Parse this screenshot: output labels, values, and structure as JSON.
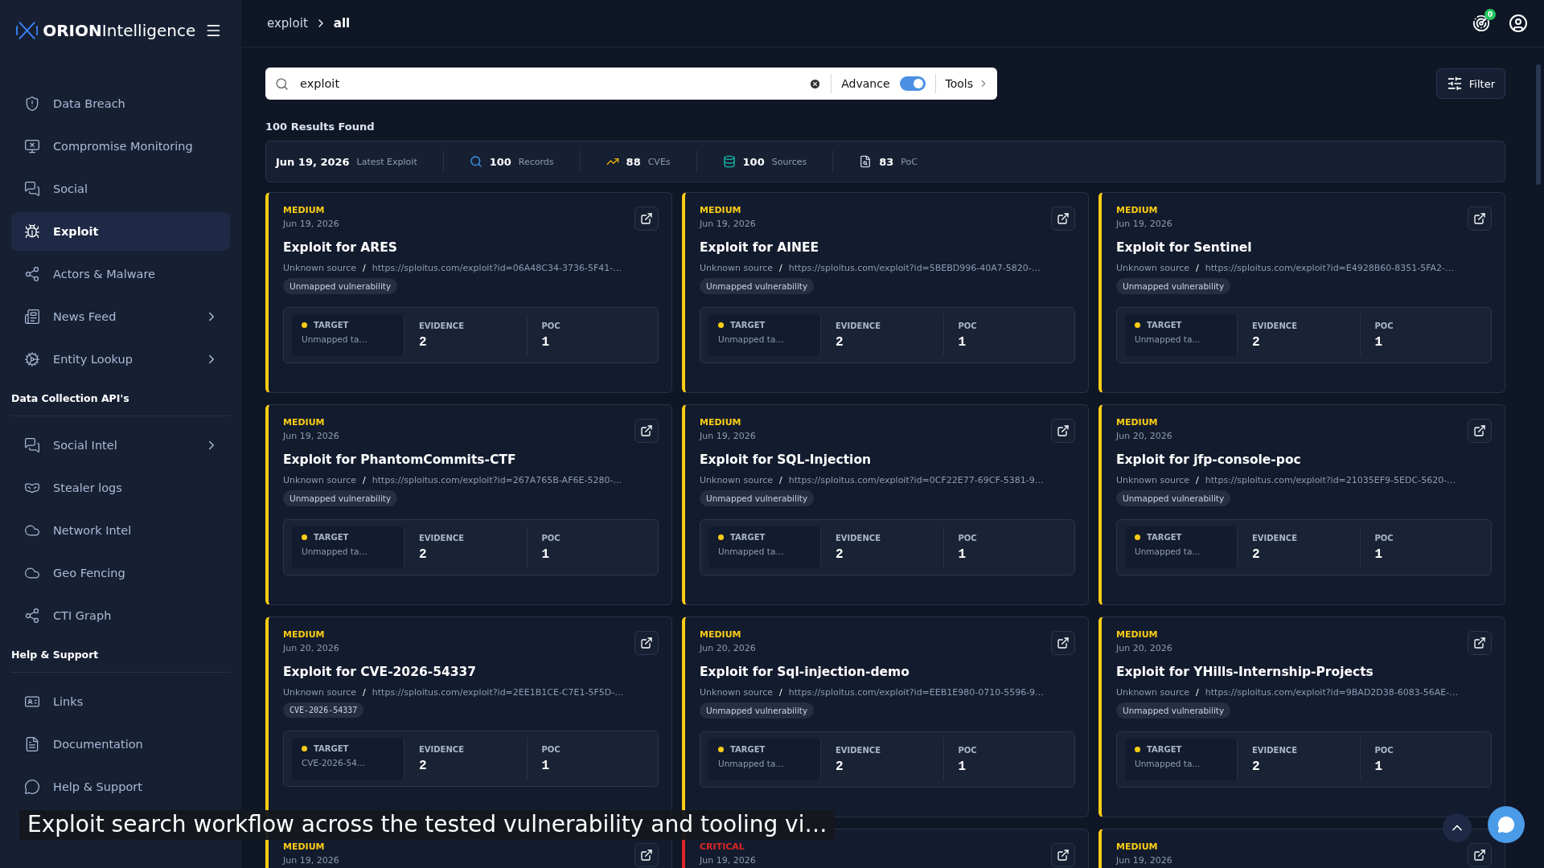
{
  "brand": {
    "name": "ORION",
    "suffix": "Intelligence"
  },
  "sidebar": {
    "items": [
      {
        "kind": "item",
        "label": "Data Breach",
        "selected": false,
        "submenu": false
      },
      {
        "kind": "item",
        "label": "Compromise Monitoring",
        "selected": false,
        "submenu": false
      },
      {
        "kind": "item",
        "label": "Social",
        "selected": false,
        "submenu": false
      },
      {
        "kind": "item",
        "label": "Exploit",
        "selected": true,
        "submenu": false
      },
      {
        "kind": "item",
        "label": "Actors & Malware",
        "selected": false,
        "submenu": false
      },
      {
        "kind": "item",
        "label": "News Feed",
        "selected": false,
        "submenu": true
      },
      {
        "kind": "item",
        "label": "Entity Lookup",
        "selected": false,
        "submenu": true
      },
      {
        "kind": "section",
        "label": "Data Collection API's"
      },
      {
        "kind": "item",
        "label": "Social Intel",
        "selected": false,
        "submenu": true
      },
      {
        "kind": "item",
        "label": "Stealer logs",
        "selected": false,
        "submenu": false
      },
      {
        "kind": "item",
        "label": "Network Intel",
        "selected": false,
        "submenu": false
      },
      {
        "kind": "item",
        "label": "Geo Fencing",
        "selected": false,
        "submenu": false
      },
      {
        "kind": "item",
        "label": "CTI Graph",
        "selected": false,
        "submenu": false
      },
      {
        "kind": "section",
        "label": "Help & Support"
      },
      {
        "kind": "item",
        "label": "Links",
        "selected": false,
        "submenu": false
      },
      {
        "kind": "item",
        "label": "Documentation",
        "selected": false,
        "submenu": false
      },
      {
        "kind": "item",
        "label": "Help & Support",
        "selected": false,
        "submenu": false
      }
    ]
  },
  "breadcrumb": [
    "exploit",
    "all"
  ],
  "notifications": {
    "count": "0"
  },
  "search": {
    "value": "exploit",
    "advance_label": "Advance",
    "advance_on": true,
    "tools_label": "Tools"
  },
  "filter_button": "Filter",
  "results_label": "100 Results Found",
  "stats": [
    {
      "kind": "date",
      "value": "Jun 19, 2026",
      "label": "Latest Exploit"
    },
    {
      "kind": "records",
      "value": "100",
      "label": "Records"
    },
    {
      "kind": "cves",
      "value": "88",
      "label": "CVEs"
    },
    {
      "kind": "sources",
      "value": "100",
      "label": "Sources"
    },
    {
      "kind": "poc",
      "value": "83",
      "label": "PoC"
    }
  ],
  "cards": [
    {
      "kind": "plain",
      "severity": "MEDIUM",
      "color": "#facc15",
      "date": "Jun 19, 2026",
      "title": "Exploit for ARES",
      "source": "Unknown source",
      "separator": "/",
      "url": "https://sploitus.com/exploit?id=06A48C34-3736-5F41-…",
      "tag": "Unmapped vulnerability",
      "target_label": "TARGET",
      "target": "Unmapped ta…",
      "evidence_label": "EVIDENCE",
      "evidence": "2",
      "poc_label": "POC",
      "poc": "1"
    },
    {
      "kind": "plain",
      "severity": "MEDIUM",
      "color": "#facc15",
      "date": "Jun 19, 2026",
      "title": "Exploit for AINEE",
      "source": "Unknown source",
      "separator": "/",
      "url": "https://sploitus.com/exploit?id=5BEBD996-40A7-5820-…",
      "tag": "Unmapped vulnerability",
      "target_label": "TARGET",
      "target": "Unmapped ta…",
      "evidence_label": "EVIDENCE",
      "evidence": "2",
      "poc_label": "POC",
      "poc": "1"
    },
    {
      "kind": "plain",
      "severity": "MEDIUM",
      "color": "#facc15",
      "date": "Jun 19, 2026",
      "title": "Exploit for Sentinel",
      "source": "Unknown source",
      "separator": "/",
      "url": "https://sploitus.com/exploit?id=E4928B60-8351-5FA2-…",
      "tag": "Unmapped vulnerability",
      "target_label": "TARGET",
      "target": "Unmapped ta…",
      "evidence_label": "EVIDENCE",
      "evidence": "2",
      "poc_label": "POC",
      "poc": "1"
    },
    {
      "kind": "plain",
      "severity": "MEDIUM",
      "color": "#facc15",
      "date": "Jun 19, 2026",
      "title": "Exploit for PhantomCommits-CTF",
      "source": "Unknown source",
      "separator": "/",
      "url": "https://sploitus.com/exploit?id=267A765B-AF6E-5280-…",
      "tag": "Unmapped vulnerability",
      "target_label": "TARGET",
      "target": "Unmapped ta…",
      "evidence_label": "EVIDENCE",
      "evidence": "2",
      "poc_label": "POC",
      "poc": "1"
    },
    {
      "kind": "plain",
      "severity": "MEDIUM",
      "color": "#facc15",
      "date": "Jun 19, 2026",
      "title": "Exploit for SQL-Injection",
      "source": "Unknown source",
      "separator": "/",
      "url": "https://sploitus.com/exploit?id=0CF22E77-69CF-5381-9…",
      "tag": "Unmapped vulnerability",
      "target_label": "TARGET",
      "target": "Unmapped ta…",
      "evidence_label": "EVIDENCE",
      "evidence": "2",
      "poc_label": "POC",
      "poc": "1"
    },
    {
      "kind": "plain",
      "severity": "MEDIUM",
      "color": "#facc15",
      "date": "Jun 20, 2026",
      "title": "Exploit for jfp-console-poc",
      "source": "Unknown source",
      "separator": "/",
      "url": "https://sploitus.com/exploit?id=21035EF9-5EDC-5620-…",
      "tag": "Unmapped vulnerability",
      "target_label": "TARGET",
      "target": "Unmapped ta…",
      "evidence_label": "EVIDENCE",
      "evidence": "2",
      "poc_label": "POC",
      "poc": "1"
    },
    {
      "kind": "cve",
      "severity": "MEDIUM",
      "color": "#facc15",
      "date": "Jun 20, 2026",
      "title": "Exploit for CVE-2026-54337",
      "source": "Unknown source",
      "separator": "/",
      "url": "https://sploitus.com/exploit?id=2EE1B1CE-C7E1-5F5D-…",
      "tag": "CVE-2026-54337",
      "target_label": "TARGET",
      "target": "CVE-2026-54…",
      "evidence_label": "EVIDENCE",
      "evidence": "2",
      "poc_label": "POC",
      "poc": "1"
    },
    {
      "kind": "plain",
      "severity": "MEDIUM",
      "color": "#facc15",
      "date": "Jun 20, 2026",
      "title": "Exploit for Sql-injection-demo",
      "source": "Unknown source",
      "separator": "/",
      "url": "https://sploitus.com/exploit?id=EEB1E980-0710-5596-9…",
      "tag": "Unmapped vulnerability",
      "target_label": "TARGET",
      "target": "Unmapped ta…",
      "evidence_label": "EVIDENCE",
      "evidence": "2",
      "poc_label": "POC",
      "poc": "1"
    },
    {
      "kind": "plain",
      "severity": "MEDIUM",
      "color": "#facc15",
      "date": "Jun 20, 2026",
      "title": "Exploit for YHills-Internship-Projects",
      "source": "Unknown source",
      "separator": "/",
      "url": "https://sploitus.com/exploit?id=9BAD2D38-6083-56AE-…",
      "tag": "Unmapped vulnerability",
      "target_label": "TARGET",
      "target": "Unmapped ta…",
      "evidence_label": "EVIDENCE",
      "evidence": "2",
      "poc_label": "POC",
      "poc": "1"
    },
    {
      "severity": "MEDIUM",
      "color": "#facc15",
      "date": "Jun 19, 2026"
    },
    {
      "severity": "CRITICAL",
      "color": "#dc2626",
      "date": "Jun 19, 2026"
    },
    {
      "severity": "MEDIUM",
      "color": "#facc15",
      "date": "Jun 19, 2026"
    }
  ],
  "caption": "Exploit search workflow across the tested vulnerability and tooling vi…"
}
